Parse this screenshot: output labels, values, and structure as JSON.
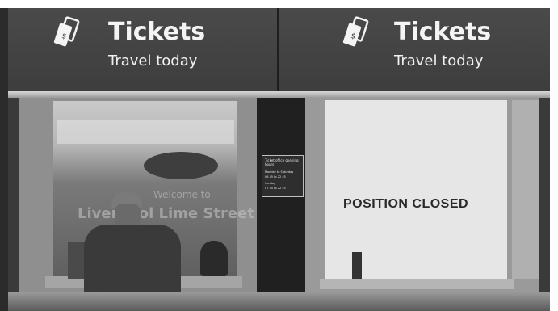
{
  "signs": [
    {
      "title": "Tickets",
      "subtitle": "Travel today",
      "icon": "ticket-icon"
    },
    {
      "title": "Tickets",
      "subtitle": "Travel today",
      "icon": "ticket-icon"
    }
  ],
  "right_window": {
    "notice": "POSITION CLOSED"
  },
  "left_window": {
    "glass_line1": "Welcome to",
    "glass_line2": "Liverpool Lime Street"
  },
  "hours_panel": {
    "title": "Ticket office opening hours",
    "lines": [
      "Monday to Saturday",
      "06 45 to 22 45",
      "Sunday",
      "07 45 to 22 45"
    ]
  },
  "colors": {
    "sign_bg": "#404040",
    "sign_text": "#f4f4f4",
    "notice_bg": "#e6e6e6"
  }
}
